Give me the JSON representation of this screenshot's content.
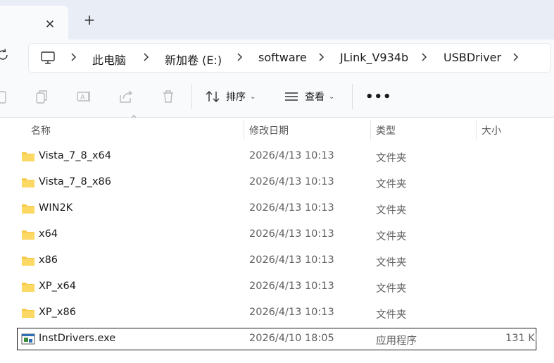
{
  "tabbar": {
    "close_glyph": "✕",
    "new_tab_glyph": "+"
  },
  "address": {
    "root_icon": "computer-icon",
    "crumbs": [
      "此电脑",
      "新加卷 (E:)",
      "software",
      "JLink_V934b",
      "USBDriver"
    ]
  },
  "toolbar": {
    "sort_label": "排序",
    "view_label": "查看",
    "more_label": "•••",
    "icons": [
      "paste-icon",
      "copy-icon",
      "rename-icon",
      "share-icon",
      "delete-icon"
    ]
  },
  "columns": {
    "name": "名称",
    "date": "修改日期",
    "type": "类型",
    "size": "大小"
  },
  "files": [
    {
      "name": "Vista_7_8_x64",
      "date": "2026/4/13 10:13",
      "type": "文件夹",
      "size": "",
      "icon": "folder-icon"
    },
    {
      "name": "Vista_7_8_x86",
      "date": "2026/4/13 10:13",
      "type": "文件夹",
      "size": "",
      "icon": "folder-icon"
    },
    {
      "name": "WIN2K",
      "date": "2026/4/13 10:13",
      "type": "文件夹",
      "size": "",
      "icon": "folder-icon"
    },
    {
      "name": "x64",
      "date": "2026/4/13 10:13",
      "type": "文件夹",
      "size": "",
      "icon": "folder-icon"
    },
    {
      "name": "x86",
      "date": "2026/4/13 10:13",
      "type": "文件夹",
      "size": "",
      "icon": "folder-icon"
    },
    {
      "name": "XP_x64",
      "date": "2026/4/13 10:13",
      "type": "文件夹",
      "size": "",
      "icon": "folder-icon"
    },
    {
      "name": "XP_x86",
      "date": "2026/4/13 10:13",
      "type": "文件夹",
      "size": "",
      "icon": "folder-icon"
    },
    {
      "name": "InstDrivers.exe",
      "date": "2026/4/10 18:05",
      "type": "应用程序",
      "size": "131 KB",
      "icon": "exe-icon"
    }
  ],
  "colors": {
    "tabstrip_bg": "#e9eef6",
    "toolbar_bg": "#f9fafc",
    "folder_yellow": "#f7c948",
    "text_secondary": "#5f5f5f"
  }
}
